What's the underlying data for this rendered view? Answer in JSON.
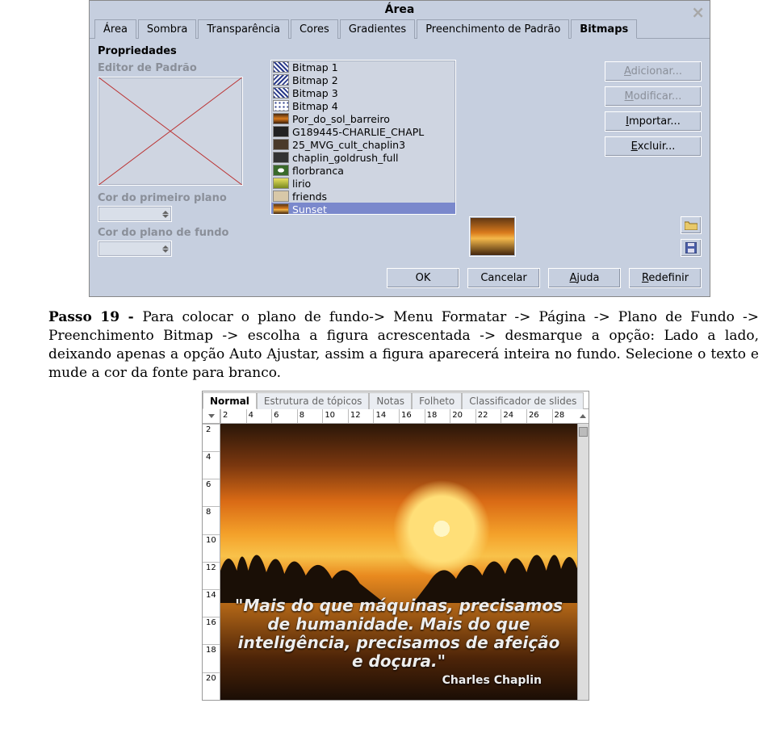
{
  "dialog": {
    "title": "Área",
    "tabs": [
      "Área",
      "Sombra",
      "Transparência",
      "Cores",
      "Gradientes",
      "Preenchimento de Padrão",
      "Bitmaps"
    ],
    "active_tab": 6,
    "props_label": "Propriedades",
    "editor_label": "Editor de Padrão",
    "fg_label": "Cor do primeiro plano",
    "bg_label": "Cor do plano de fundo",
    "bitmaps": [
      {
        "label": "Bitmap 1"
      },
      {
        "label": "Bitmap 2"
      },
      {
        "label": "Bitmap 3"
      },
      {
        "label": "Bitmap 4"
      },
      {
        "label": "Por_do_sol_barreiro"
      },
      {
        "label": "G189445-CHARLIE_CHAPL"
      },
      {
        "label": "25_MVG_cult_chaplin3"
      },
      {
        "label": "chaplin_goldrush_full"
      },
      {
        "label": "florbranca"
      },
      {
        "label": "lirio"
      },
      {
        "label": "friends"
      },
      {
        "label": "Sunset"
      }
    ],
    "bitmaps_selected": 11,
    "buttons": {
      "add": "Adicionar...",
      "modify": "Modificar...",
      "import": "Importar...",
      "delete": "Excluir..."
    },
    "footer": {
      "ok": "OK",
      "cancel": "Cancelar",
      "help": "Ajuda",
      "reset": "Redefinir"
    }
  },
  "step_text": {
    "bold": "Passo 19 - ",
    "rest": "Para colocar o plano de fundo-> Menu Formatar -> Página -> Plano de Fundo -> Preenchimento Bitmap -> escolha a figura acrescentada -> desmarque a opção: Lado a lado, deixando apenas a opção Auto Ajustar, assim a figura aparecerá inteira no fundo. Selecione o texto e mude a cor da fonte para branco."
  },
  "impress": {
    "tabs": [
      "Normal",
      "Estrutura de tópicos",
      "Notas",
      "Folheto",
      "Classificador de slides"
    ],
    "active_tab": 0,
    "h_ticks": [
      "2",
      "4",
      "6",
      "8",
      "10",
      "12",
      "14",
      "16",
      "18",
      "20",
      "22",
      "24",
      "26",
      "28"
    ],
    "v_ticks": [
      "2",
      "4",
      "6",
      "8",
      "10",
      "12",
      "14",
      "16",
      "18",
      "20"
    ],
    "quote": "\"Mais do que máquinas, precisamos de humanidade. Mais do que inteligência, precisamos de afeição e doçura.\"",
    "author": "Charles Chaplin"
  }
}
